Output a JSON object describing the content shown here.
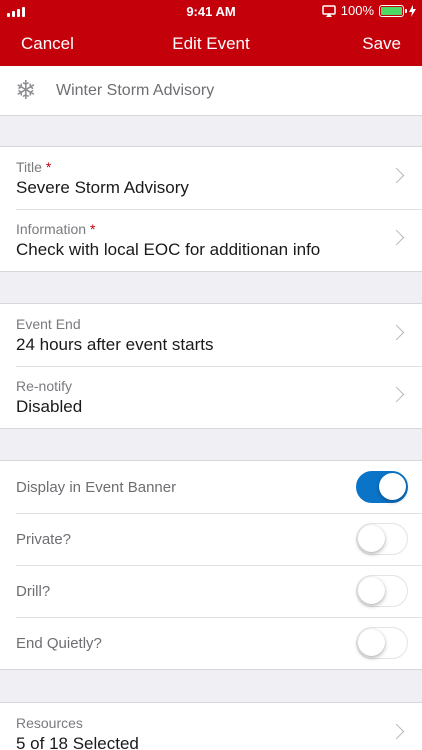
{
  "status_bar": {
    "time": "9:41 AM",
    "battery_percent": "100%",
    "battery_level": 1.0,
    "icons": [
      "signal-icon",
      "airplay-icon",
      "battery-icon",
      "charging-icon"
    ]
  },
  "nav": {
    "cancel_label": "Cancel",
    "title": "Edit Event",
    "save_label": "Save"
  },
  "event_header": {
    "icon": "snowflake-icon",
    "icon_glyph": "❄",
    "name": "Winter Storm Advisory"
  },
  "details": {
    "title_label": "Title",
    "title_value": "Severe Storm Advisory",
    "information_label": "Information",
    "information_value": "Check with local EOC for additionan info",
    "required_mark": "*"
  },
  "timing": {
    "event_end_label": "Event End",
    "event_end_value": "24 hours after event starts",
    "renotify_label": "Re-notify",
    "renotify_value": "Disabled"
  },
  "toggles": [
    {
      "label": "Display in Event Banner",
      "on": true
    },
    {
      "label": "Private?",
      "on": false
    },
    {
      "label": "Drill?",
      "on": false
    },
    {
      "label": "End Quietly?",
      "on": false
    }
  ],
  "resources": {
    "label": "Resources",
    "value": "5 of 18 Selected"
  },
  "colors": {
    "brand_red": "#c4000b",
    "toggle_on_blue": "#0a74c8",
    "battery_green": "#4cd964",
    "background_gray": "#efeff4"
  }
}
